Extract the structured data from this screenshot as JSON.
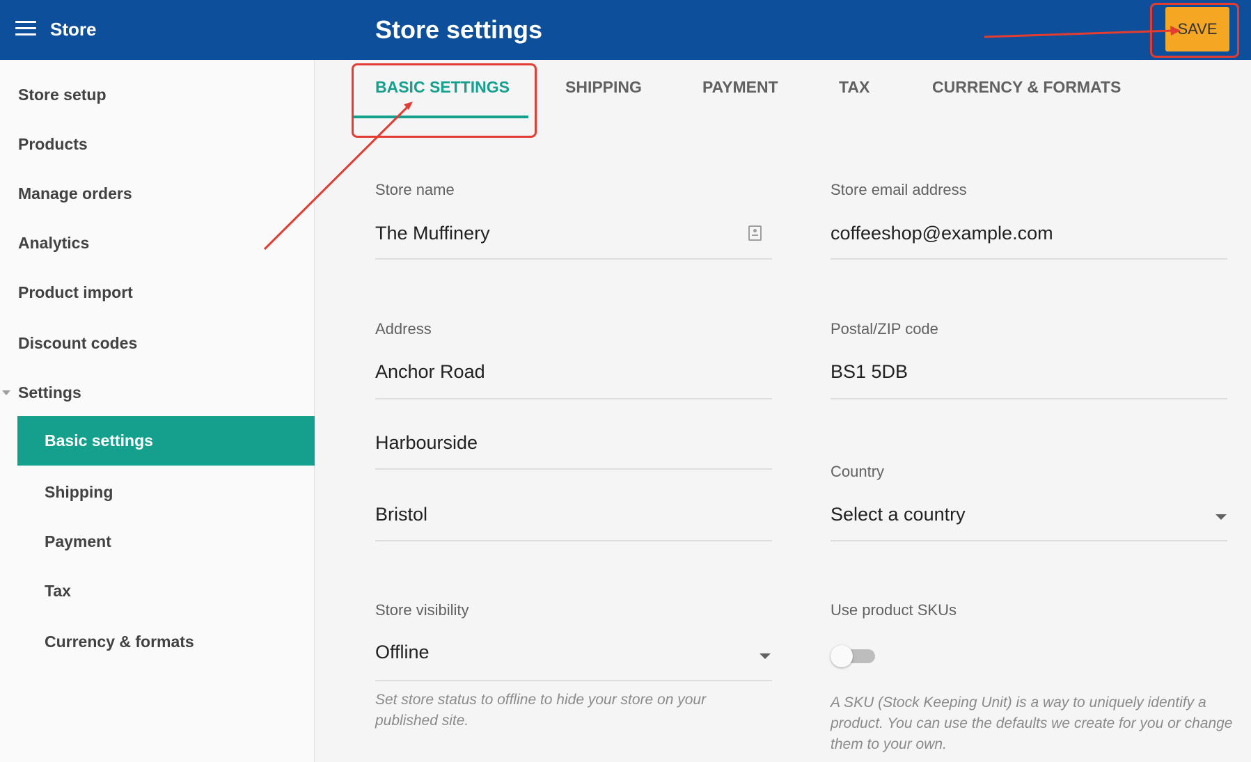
{
  "header": {
    "menu_icon": "hamburger-menu-icon",
    "app_title": "Store",
    "page_title": "Store settings",
    "save_label": "SAVE"
  },
  "sidebar": {
    "items": [
      {
        "label": "Store setup"
      },
      {
        "label": "Products"
      },
      {
        "label": "Manage orders"
      },
      {
        "label": "Analytics"
      },
      {
        "label": "Product import"
      },
      {
        "label": "Discount codes"
      },
      {
        "label": "Settings",
        "expanded": true
      },
      {
        "label": "Basic settings",
        "active": true
      },
      {
        "label": "Shipping"
      },
      {
        "label": "Payment"
      },
      {
        "label": "Tax"
      },
      {
        "label": "Currency & formats"
      }
    ]
  },
  "tabs": [
    {
      "label": "BASIC SETTINGS",
      "active": true
    },
    {
      "label": "SHIPPING"
    },
    {
      "label": "PAYMENT"
    },
    {
      "label": "TAX"
    },
    {
      "label": "CURRENCY & FORMATS"
    }
  ],
  "form": {
    "store_name": {
      "label": "Store name",
      "value": "The Muffinery"
    },
    "store_email": {
      "label": "Store email address",
      "value": "coffeeshop@example.com"
    },
    "address": {
      "label": "Address",
      "line1": "Anchor Road",
      "line2": "Harbourside",
      "line3": "Bristol"
    },
    "postal": {
      "label": "Postal/ZIP code",
      "value": "BS1 5DB"
    },
    "country": {
      "label": "Country",
      "value": "Select a country"
    },
    "visibility": {
      "label": "Store visibility",
      "value": "Offline",
      "helper": "Set store status to offline to hide your store on your published site."
    },
    "skus": {
      "label": "Use product SKUs",
      "enabled": false,
      "helper": "A SKU (Stock Keeping Unit) is a way to uniquely identify a product. You can use the defaults we create for you or change them to your own."
    }
  },
  "colors": {
    "header_bg": "#0d4f9a",
    "accent": "#15a08e",
    "save_bg": "#f5a623",
    "annotation": "#e23c33"
  }
}
